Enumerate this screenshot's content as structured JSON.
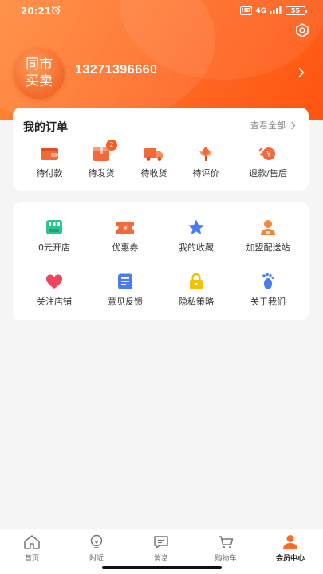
{
  "status_bar": {
    "time": "20:21",
    "network": "4G",
    "hd": "HD",
    "battery": "55"
  },
  "profile": {
    "avatar_line1": "同市",
    "avatar_line2": "买卖",
    "phone": "13271396660"
  },
  "orders": {
    "title": "我的订单",
    "view_all": "查看全部",
    "items": [
      {
        "label": "待付款",
        "icon": "wallet-icon"
      },
      {
        "label": "待发货",
        "icon": "package-icon",
        "badge": "2"
      },
      {
        "label": "待收货",
        "icon": "truck-icon"
      },
      {
        "label": "待评价",
        "icon": "flower-review-icon"
      },
      {
        "label": "退款/售后",
        "icon": "refund-icon"
      }
    ]
  },
  "services": {
    "items": [
      {
        "label": "0元开店",
        "icon": "shop-icon"
      },
      {
        "label": "优惠券",
        "icon": "coupon-icon"
      },
      {
        "label": "我的收藏",
        "icon": "star-icon"
      },
      {
        "label": "加盟配送站",
        "icon": "person-icon"
      },
      {
        "label": "关注店铺",
        "icon": "heart-icon"
      },
      {
        "label": "意见反馈",
        "icon": "feedback-icon"
      },
      {
        "label": "隐私策略",
        "icon": "lock-icon"
      },
      {
        "label": "关于我们",
        "icon": "footprint-icon"
      }
    ]
  },
  "tabbar": {
    "items": [
      {
        "label": "首页",
        "icon": "home-icon"
      },
      {
        "label": "附近",
        "icon": "nearby-icon"
      },
      {
        "label": "消息",
        "icon": "message-icon"
      },
      {
        "label": "购物车",
        "icon": "cart-icon"
      },
      {
        "label": "会员中心",
        "icon": "member-icon",
        "active": true
      }
    ]
  },
  "colors": {
    "accent": "#ff6a24",
    "badge": "#ff5a1f",
    "star": "#4a7cf0",
    "heart": "#f0455a"
  }
}
